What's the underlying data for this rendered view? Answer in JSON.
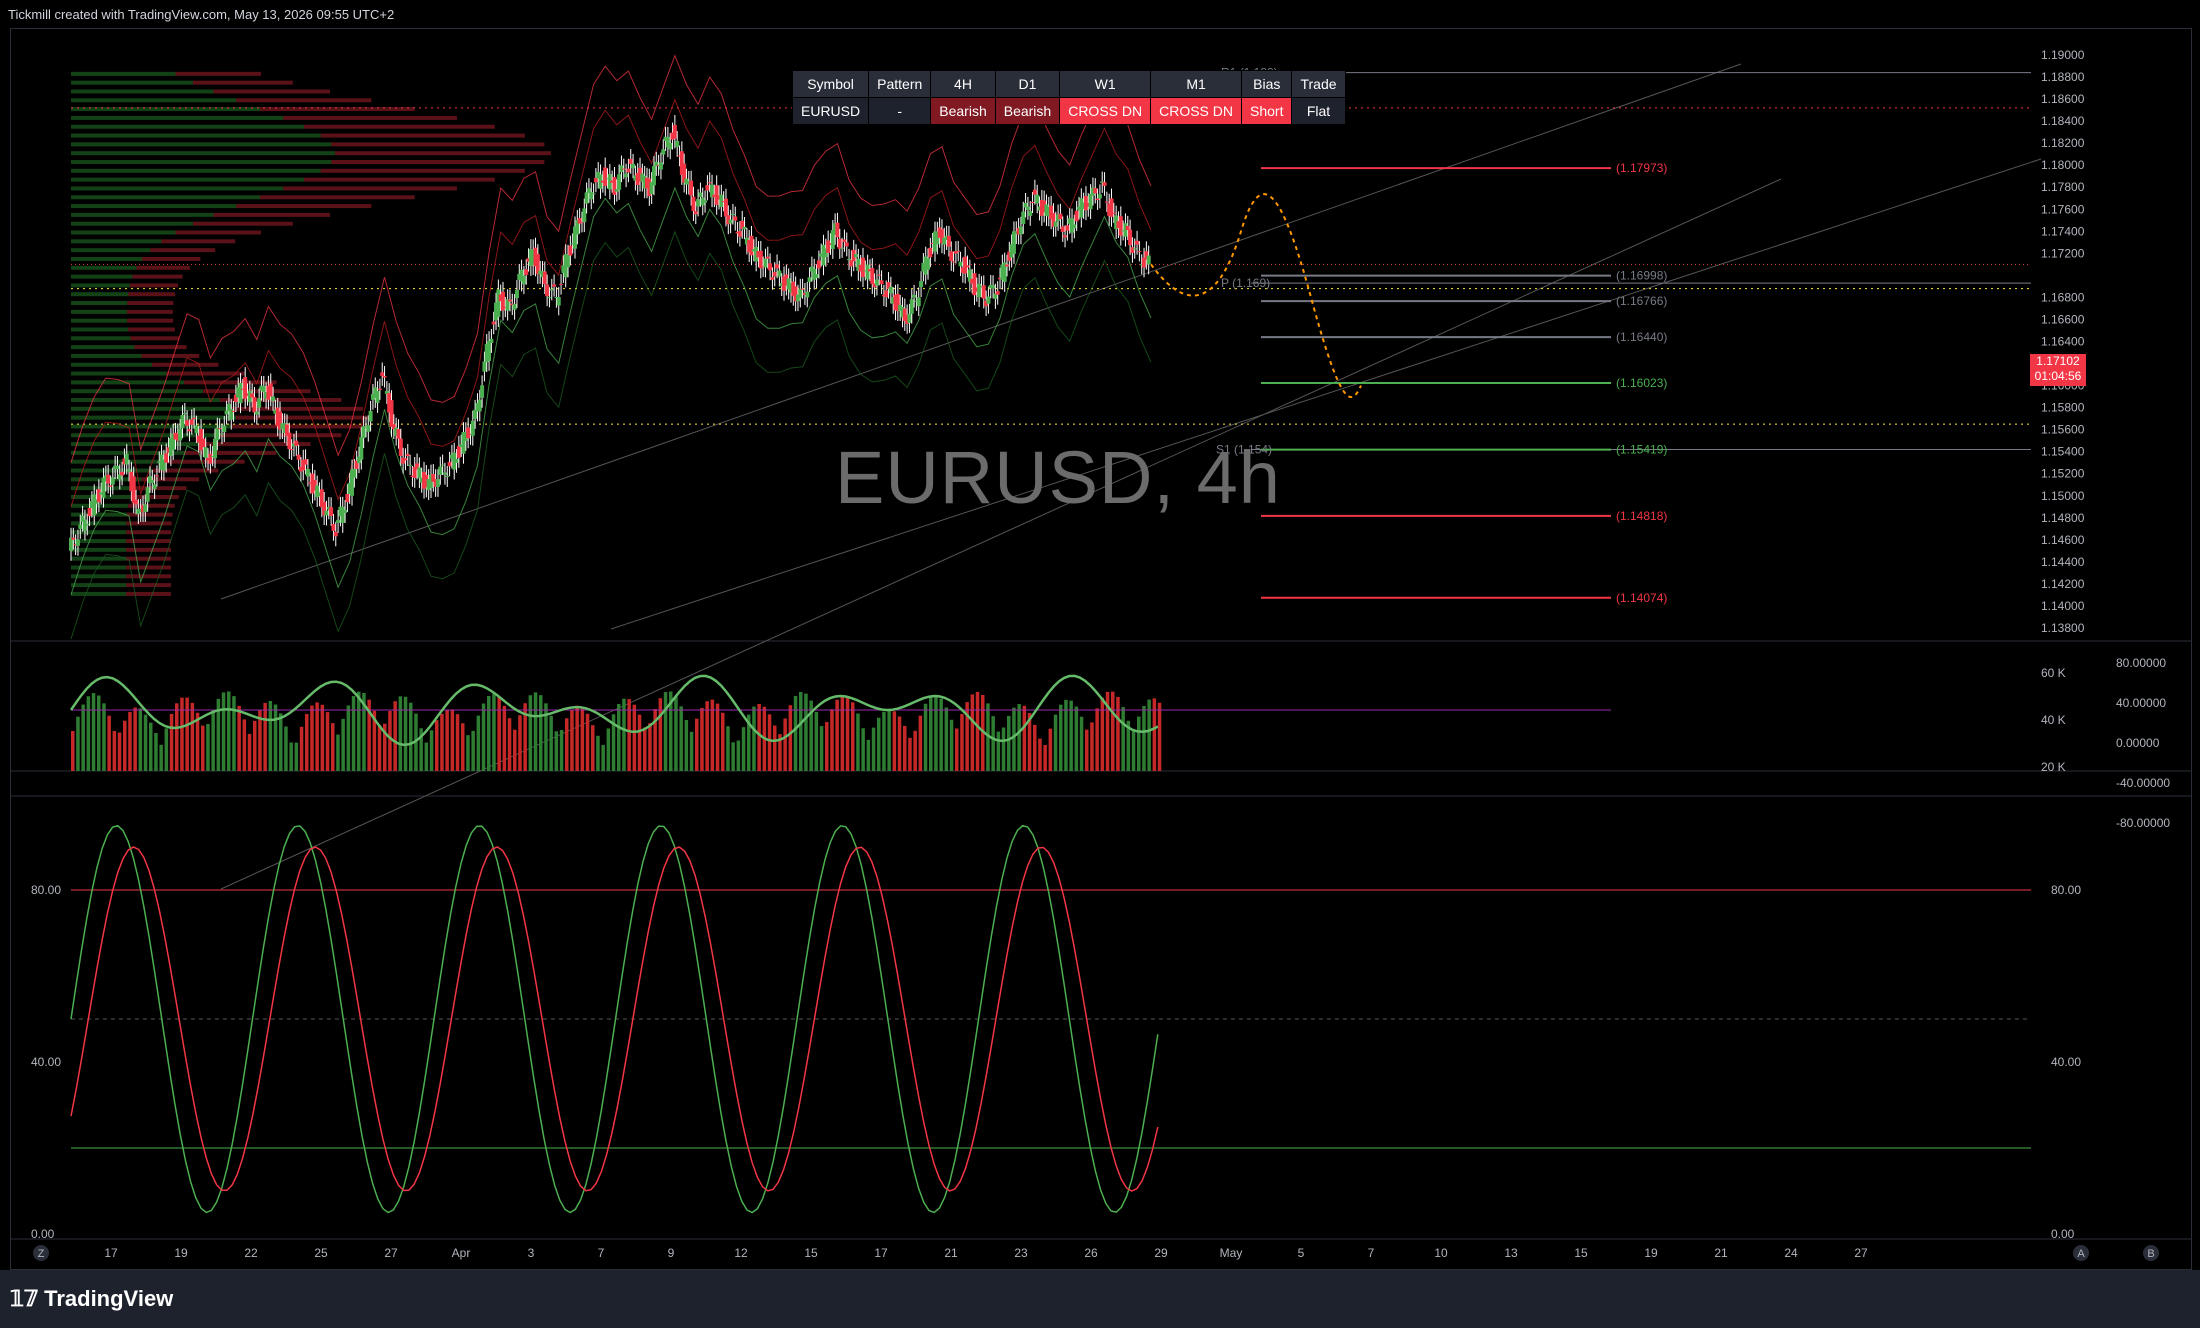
{
  "header": {
    "text": "Tickmill created with TradingView.com, May 13, 2026 09:55 UTC+2"
  },
  "watermark": "EURUSD, 4h",
  "footer": {
    "logo_text": "TradingView"
  },
  "bias_table": {
    "headers": [
      "Symbol",
      "Pattern",
      "4H",
      "D1",
      "W1",
      "M1",
      "Bias",
      "Trade"
    ],
    "row": [
      "EURUSD",
      "-",
      "Bearish",
      "Bearish",
      "CROSS DN",
      "CROSS DN",
      "Short",
      "Flat"
    ]
  },
  "last_price": {
    "value": "1.17102",
    "countdown": "01:04:56"
  },
  "chart_data": [
    {
      "type": "candlestick",
      "symbol": "EURUSD",
      "timeframe": "4h",
      "ylim": [
        1.137,
        1.191
      ],
      "y_ticks": [
        "1.19000",
        "1.18800",
        "1.18600",
        "1.18400",
        "1.18200",
        "1.18000",
        "1.17800",
        "1.17600",
        "1.17400",
        "1.17200",
        "1.16800",
        "1.16600",
        "1.16400",
        "1.16200",
        "1.16000",
        "1.15800",
        "1.15600",
        "1.15400",
        "1.15200",
        "1.15000",
        "1.14800",
        "1.14600",
        "1.14400",
        "1.14200",
        "1.14000",
        "1.13800"
      ],
      "x_ticks": [
        "17",
        "19",
        "22",
        "25",
        "27",
        "Apr",
        "3",
        "7",
        "9",
        "12",
        "15",
        "17",
        "21",
        "23",
        "26",
        "29",
        "May",
        "5",
        "7",
        "10",
        "13",
        "15",
        "19",
        "21",
        "24",
        "27"
      ],
      "close_path": [
        [
          0,
          1.145
        ],
        [
          5,
          1.147
        ],
        [
          10,
          1.149
        ],
        [
          15,
          1.151
        ],
        [
          20,
          1.152
        ],
        [
          25,
          1.153
        ],
        [
          30,
          1.148
        ],
        [
          35,
          1.151
        ],
        [
          40,
          1.153
        ],
        [
          45,
          1.155
        ],
        [
          50,
          1.157
        ],
        [
          55,
          1.156
        ],
        [
          60,
          1.153
        ],
        [
          65,
          1.156
        ],
        [
          70,
          1.158
        ],
        [
          75,
          1.16
        ],
        [
          80,
          1.158
        ],
        [
          85,
          1.16
        ],
        [
          90,
          1.157
        ],
        [
          95,
          1.155
        ],
        [
          100,
          1.153
        ],
        [
          105,
          1.151
        ],
        [
          110,
          1.149
        ],
        [
          115,
          1.147
        ],
        [
          120,
          1.15
        ],
        [
          125,
          1.154
        ],
        [
          130,
          1.158
        ],
        [
          135,
          1.161
        ],
        [
          140,
          1.156
        ],
        [
          145,
          1.153
        ],
        [
          150,
          1.152
        ],
        [
          155,
          1.151
        ],
        [
          160,
          1.152
        ],
        [
          165,
          1.153
        ],
        [
          170,
          1.155
        ],
        [
          175,
          1.157
        ],
        [
          180,
          1.163
        ],
        [
          185,
          1.168
        ],
        [
          190,
          1.167
        ],
        [
          195,
          1.17
        ],
        [
          200,
          1.172
        ],
        [
          205,
          1.169
        ],
        [
          210,
          1.168
        ],
        [
          215,
          1.172
        ],
        [
          220,
          1.175
        ],
        [
          225,
          1.178
        ],
        [
          230,
          1.179
        ],
        [
          235,
          1.178
        ],
        [
          240,
          1.18
        ],
        [
          245,
          1.179
        ],
        [
          250,
          1.178
        ],
        [
          255,
          1.181
        ],
        [
          260,
          1.183
        ],
        [
          265,
          1.179
        ],
        [
          270,
          1.176
        ],
        [
          275,
          1.178
        ],
        [
          280,
          1.177
        ],
        [
          285,
          1.175
        ],
        [
          290,
          1.174
        ],
        [
          295,
          1.172
        ],
        [
          300,
          1.171
        ],
        [
          305,
          1.17
        ],
        [
          310,
          1.169
        ],
        [
          315,
          1.168
        ],
        [
          320,
          1.17
        ],
        [
          325,
          1.172
        ],
        [
          330,
          1.174
        ],
        [
          335,
          1.172
        ],
        [
          340,
          1.171
        ],
        [
          345,
          1.17
        ],
        [
          350,
          1.169
        ],
        [
          355,
          1.168
        ],
        [
          360,
          1.166
        ],
        [
          365,
          1.168
        ],
        [
          370,
          1.172
        ],
        [
          375,
          1.174
        ],
        [
          380,
          1.172
        ],
        [
          385,
          1.171
        ],
        [
          390,
          1.169
        ],
        [
          395,
          1.168
        ],
        [
          400,
          1.169
        ],
        [
          405,
          1.172
        ],
        [
          410,
          1.175
        ],
        [
          415,
          1.177
        ],
        [
          420,
          1.176
        ],
        [
          425,
          1.175
        ],
        [
          430,
          1.174
        ],
        [
          435,
          1.176
        ],
        [
          440,
          1.177
        ],
        [
          445,
          1.178
        ],
        [
          450,
          1.175
        ],
        [
          455,
          1.174
        ],
        [
          460,
          1.172
        ],
        [
          465,
          1.171
        ]
      ],
      "levels": [
        {
          "label": "(1.17973)",
          "value": 1.17973,
          "color": "#f23645"
        },
        {
          "label": "(1.16998)",
          "value": 1.16998,
          "color": "#787b86"
        },
        {
          "label": "(1.16766)",
          "value": 1.16766,
          "color": "#787b86"
        },
        {
          "label": "(1.16440)",
          "value": 1.1644,
          "color": "#787b86"
        },
        {
          "label": "(1.16023)",
          "value": 1.16023,
          "color": "#4caf50"
        },
        {
          "label": "(1.15419)",
          "value": 1.15419,
          "color": "#4caf50"
        },
        {
          "label": "(1.14818)",
          "value": 1.14818,
          "color": "#f23645"
        },
        {
          "label": "(1.14074)",
          "value": 1.14074,
          "color": "#f23645"
        }
      ],
      "level_tags": [
        "R1 (1.188)",
        "P (1.169)",
        "S1 (1.154)"
      ],
      "projection": [
        [
          1.171
        ],
        [
          1.168
        ],
        [
          1.176
        ],
        [
          1.16
        ]
      ],
      "colors": {
        "up": "#4caf50",
        "down": "#f23645",
        "projection": "#ff9800"
      }
    },
    {
      "type": "bar+line",
      "name": "volume-oscillator",
      "y_ticks_left": [
        "60 K",
        "40 K",
        "20 K"
      ],
      "y_ticks_right": [
        "80.00000",
        "40.00000",
        "0.00000",
        "-40.00000",
        "-80.00000"
      ],
      "ylim": [
        -80,
        80
      ]
    },
    {
      "type": "line",
      "name": "stochastic",
      "y_ticks": [
        "80.00",
        "40.00",
        "0.00"
      ],
      "ylim": [
        0,
        100
      ],
      "levels": [
        80,
        20
      ]
    }
  ],
  "bottom_axis_buttons": [
    "Z",
    "A",
    "B"
  ]
}
